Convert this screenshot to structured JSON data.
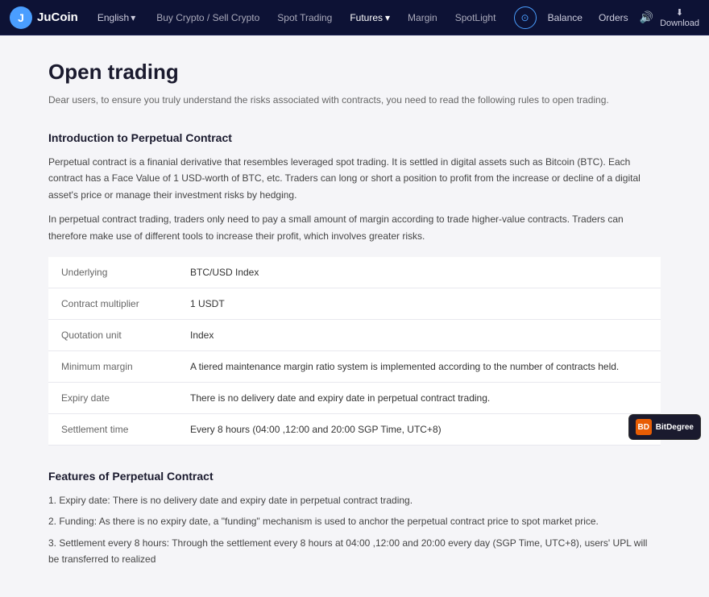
{
  "navbar": {
    "logo_text": "JuCoin",
    "lang_label": "English",
    "nav_items": [
      {
        "label": "Buy Crypto / Sell Crypto",
        "id": "buy-crypto"
      },
      {
        "label": "Spot Trading",
        "id": "spot-trading"
      },
      {
        "label": "Futures",
        "id": "futures",
        "has_dropdown": true
      },
      {
        "label": "Margin",
        "id": "margin"
      },
      {
        "label": "SpotLight",
        "id": "spotlight"
      }
    ],
    "balance_label": "Balance",
    "orders_label": "Orders",
    "download_label": "Download"
  },
  "page": {
    "title": "Open trading",
    "subtitle": "Dear users, to ensure you truly understand the risks associated with contracts, you need to read the following rules to open trading."
  },
  "section1": {
    "title": "Introduction to Perpetual Contract",
    "para1": "Perpetual contract is a finanial derivative that resembles leveraged spot trading. It is settled in digital assets such as Bitcoin (BTC). Each contract has a Face Value of 1 USD-worth of BTC, etc. Traders can long or short a position to profit from the increase or decline of a digital asset's price or manage their investment risks by hedging.",
    "para2": "In perpetual contract trading, traders only need to pay a small amount of margin according to trade higher-value contracts. Traders can therefore make use of different tools to increase their profit, which involves greater risks."
  },
  "table": {
    "rows": [
      {
        "label": "Underlying",
        "value": "BTC/USD Index"
      },
      {
        "label": "Contract multiplier",
        "value": "1 USDT"
      },
      {
        "label": "Quotation unit",
        "value": "Index"
      },
      {
        "label": "Minimum margin",
        "value": "A tiered maintenance margin ratio system is implemented according to the number of contracts held."
      },
      {
        "label": "Expiry date",
        "value": "There is no delivery date and expiry date in perpetual contract trading."
      },
      {
        "label": "Settlement time",
        "value": "Every 8 hours (04:00 ,12:00 and 20:00 SGP Time, UTC+8)"
      }
    ]
  },
  "section2": {
    "title": "Features of Perpetual Contract",
    "items": [
      "1. Expiry date: There is no delivery date and expiry date in perpetual contract trading.",
      "2. Funding: As there is no expiry date, a \"funding\" mechanism is used to anchor the perpetual contract price to spot market price.",
      "3. Settlement every 8 hours: Through the settlement every 8 hours at 04:00 ,12:00 and 20:00 every day (SGP Time, UTC+8), users' UPL will be transferred to realized"
    ]
  },
  "bitdegree": {
    "label": "BitDegree",
    "icon_text": "BD"
  }
}
